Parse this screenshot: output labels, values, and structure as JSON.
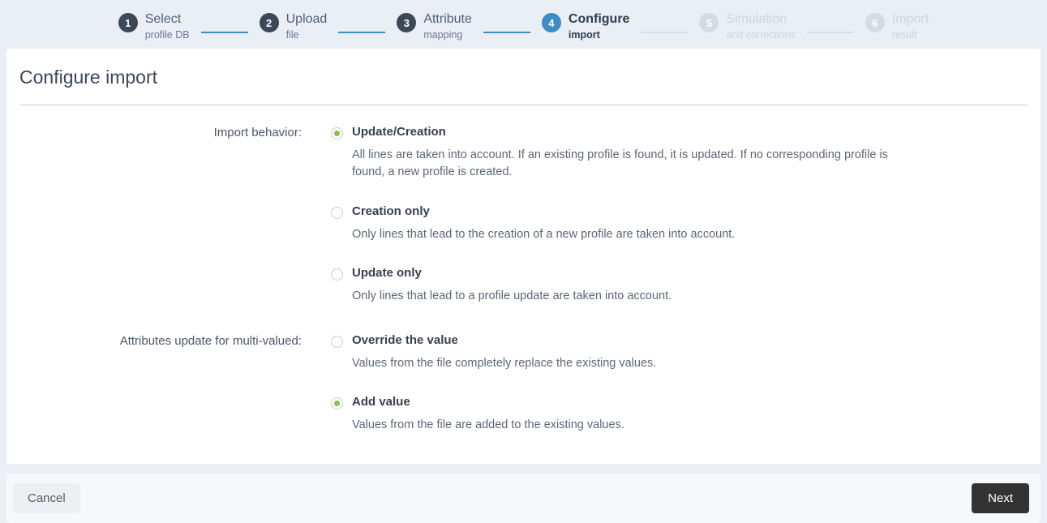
{
  "stepper": {
    "steps": [
      {
        "number": "1",
        "title": "Select",
        "sub": "profile DB",
        "state": "done"
      },
      {
        "number": "2",
        "title": "Upload",
        "sub": "file",
        "state": "done"
      },
      {
        "number": "3",
        "title": "Attribute",
        "sub": "mapping",
        "state": "done"
      },
      {
        "number": "4",
        "title": "Configure",
        "sub": "import",
        "state": "active"
      },
      {
        "number": "5",
        "title": "Simulation",
        "sub": "and corrections",
        "state": "todo"
      },
      {
        "number": "6",
        "title": "Import",
        "sub": "result",
        "state": "todo"
      }
    ]
  },
  "page": {
    "title": "Configure import"
  },
  "groups": [
    {
      "label": "Import behavior:",
      "options": [
        {
          "label": "Update/Creation",
          "description": "All lines are taken into account. If an existing profile is found, it is updated. If no corresponding profile is found, a new profile is created.",
          "selected": true
        },
        {
          "label": "Creation only",
          "description": "Only lines that lead to the creation of a new profile are taken into account.",
          "selected": false
        },
        {
          "label": "Update only",
          "description": "Only lines that lead to a profile update are taken into account.",
          "selected": false
        }
      ]
    },
    {
      "label": "Attributes update for multi-valued:",
      "options": [
        {
          "label": "Override the value",
          "description": "Values from the file completely replace the existing values.",
          "selected": false
        },
        {
          "label": "Add value",
          "description": "Values from the file are added to the existing values.",
          "selected": true
        }
      ]
    }
  ],
  "footer": {
    "cancel_label": "Cancel",
    "next_label": "Next"
  },
  "colors": {
    "page_background": "#eaeef5",
    "active_step": "#3c8dc5",
    "done_step": "#3c4858",
    "todo_step": "#d6dae2",
    "radio_selected": "#86c440",
    "next_button": "#333333"
  }
}
